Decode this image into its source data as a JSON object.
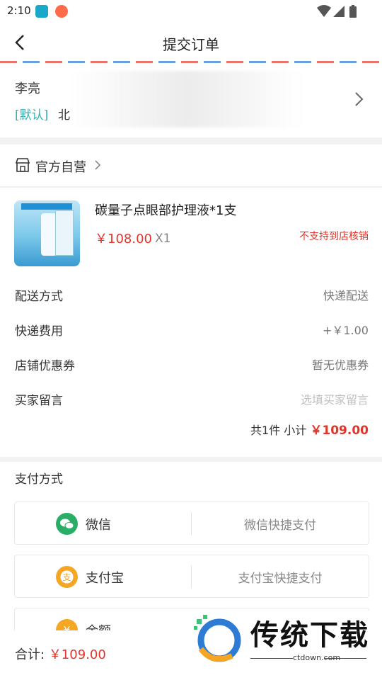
{
  "status": {
    "time": "2:10"
  },
  "header": {
    "title": "提交订单"
  },
  "address": {
    "name": "李亮",
    "default_tag": "[默认]",
    "line": "北"
  },
  "shop": {
    "name": "官方自营"
  },
  "product": {
    "name": "碳量子点眼部护理液*1支",
    "price": "￥108.00",
    "quantity": "X1",
    "notice": "不支持到店核销"
  },
  "fields": [
    {
      "label": "配送方式",
      "value": "快递配送"
    },
    {
      "label": "快递费用",
      "value": "+￥1.00"
    },
    {
      "label": "店铺优惠券",
      "value": "暂无优惠券"
    },
    {
      "label": "买家留言",
      "placeholder": "选填买家留言"
    }
  ],
  "subtotal": {
    "label": "共1件 小计",
    "amount": "￥109.00"
  },
  "payment": {
    "heading": "支付方式",
    "options": [
      {
        "name": "微信",
        "desc": "微信快捷支付",
        "color": "#2aae67",
        "icon": "wechat-icon"
      },
      {
        "name": "支付宝",
        "desc": "支付宝快捷支付",
        "color": "#f5a623",
        "icon": "alipay-icon"
      },
      {
        "name": "余额",
        "desc": "",
        "color": "#f5a623",
        "icon": "wallet-icon"
      }
    ]
  },
  "footer": {
    "total_label": "合计:",
    "total_amount": "￥109.00"
  },
  "watermark": {
    "brand": "传统下载",
    "site": "ctdown.com"
  }
}
